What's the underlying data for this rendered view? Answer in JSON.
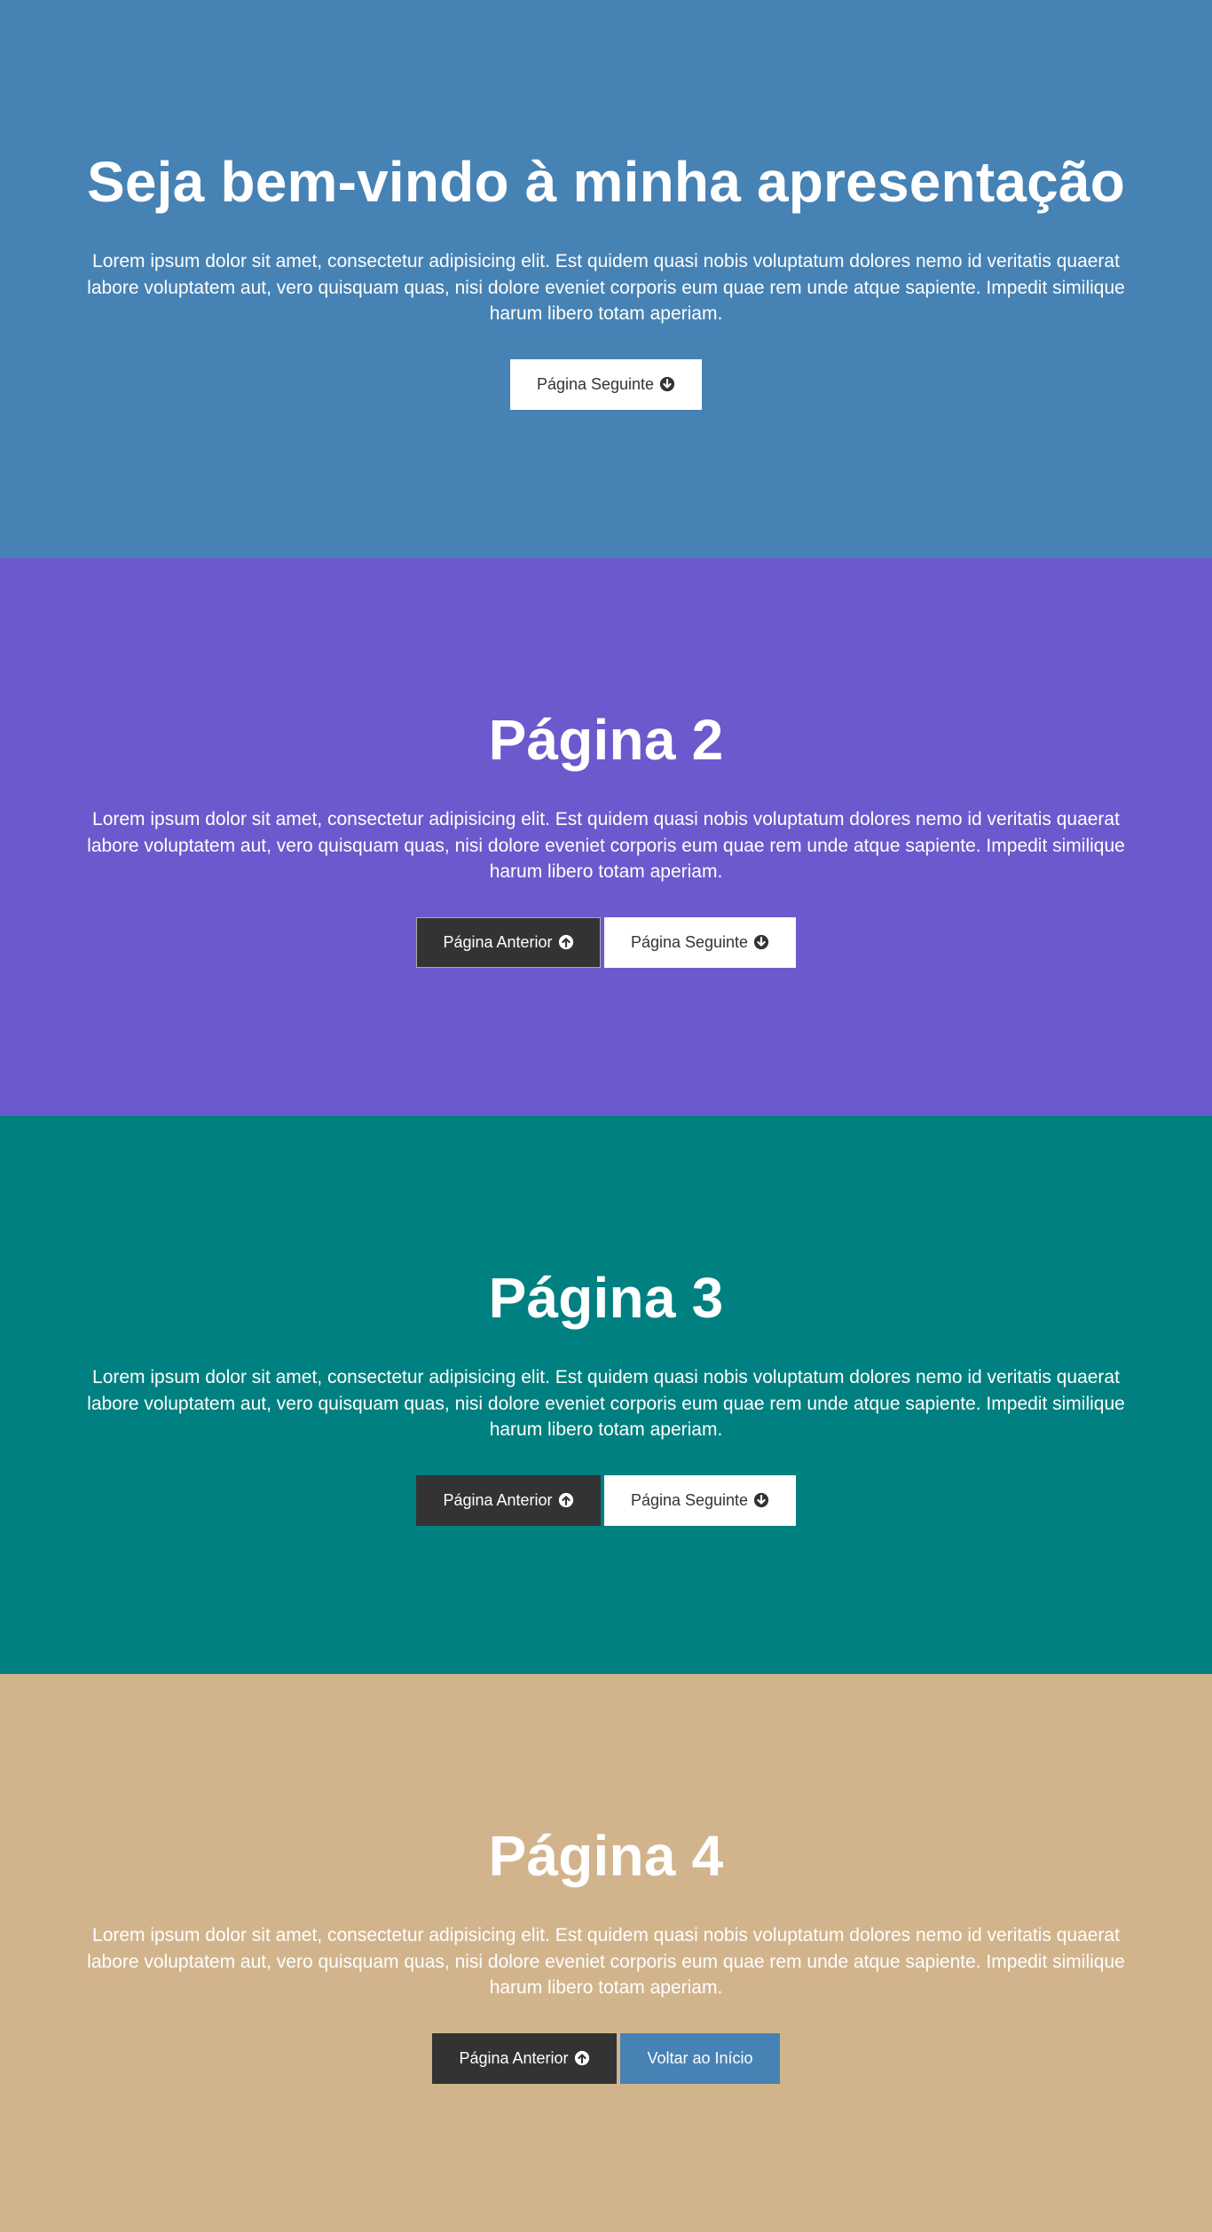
{
  "sections": [
    {
      "title": "Seja bem-vindo à minha apresentação",
      "text": "Lorem ipsum dolor sit amet, consectetur adipisicing elit. Est quidem quasi nobis voluptatum dolores nemo id veritatis quaerat labore voluptatem aut, vero quisquam quas, nisi dolore eveniet corporis eum quae rem unde atque sapiente. Impedit similique harum libero totam aperiam.",
      "next_label": "Página Seguinte"
    },
    {
      "title": "Página 2",
      "text": "Lorem ipsum dolor sit amet, consectetur adipisicing elit. Est quidem quasi nobis voluptatum dolores nemo id veritatis quaerat labore voluptatem aut, vero quisquam quas, nisi dolore eveniet corporis eum quae rem unde atque sapiente. Impedit similique harum libero totam aperiam.",
      "prev_label": "Página Anterior",
      "next_label": "Página Seguinte"
    },
    {
      "title": "Página 3",
      "text": "Lorem ipsum dolor sit amet, consectetur adipisicing elit. Est quidem quasi nobis voluptatum dolores nemo id veritatis quaerat labore voluptatem aut, vero quisquam quas, nisi dolore eveniet corporis eum quae rem unde atque sapiente. Impedit similique harum libero totam aperiam.",
      "prev_label": "Página Anterior",
      "next_label": "Página Seguinte"
    },
    {
      "title": "Página 4",
      "text": "Lorem ipsum dolor sit amet, consectetur adipisicing elit. Est quidem quasi nobis voluptatum dolores nemo id veritatis quaerat labore voluptatem aut, vero quisquam quas, nisi dolore eveniet corporis eum quae rem unde atque sapiente. Impedit similique harum libero totam aperiam.",
      "prev_label": "Página Anterior",
      "home_label": "Voltar ao Início"
    }
  ],
  "colors": {
    "section1": "#4682b4",
    "section2": "#6a5acd",
    "section3": "#008080",
    "section4": "#d2b48c",
    "button_dark": "#333333",
    "button_light": "#ffffff",
    "button_home": "#4682b4"
  },
  "icons": {
    "next": "arrow-circle-down-icon",
    "prev": "arrow-circle-up-icon"
  }
}
